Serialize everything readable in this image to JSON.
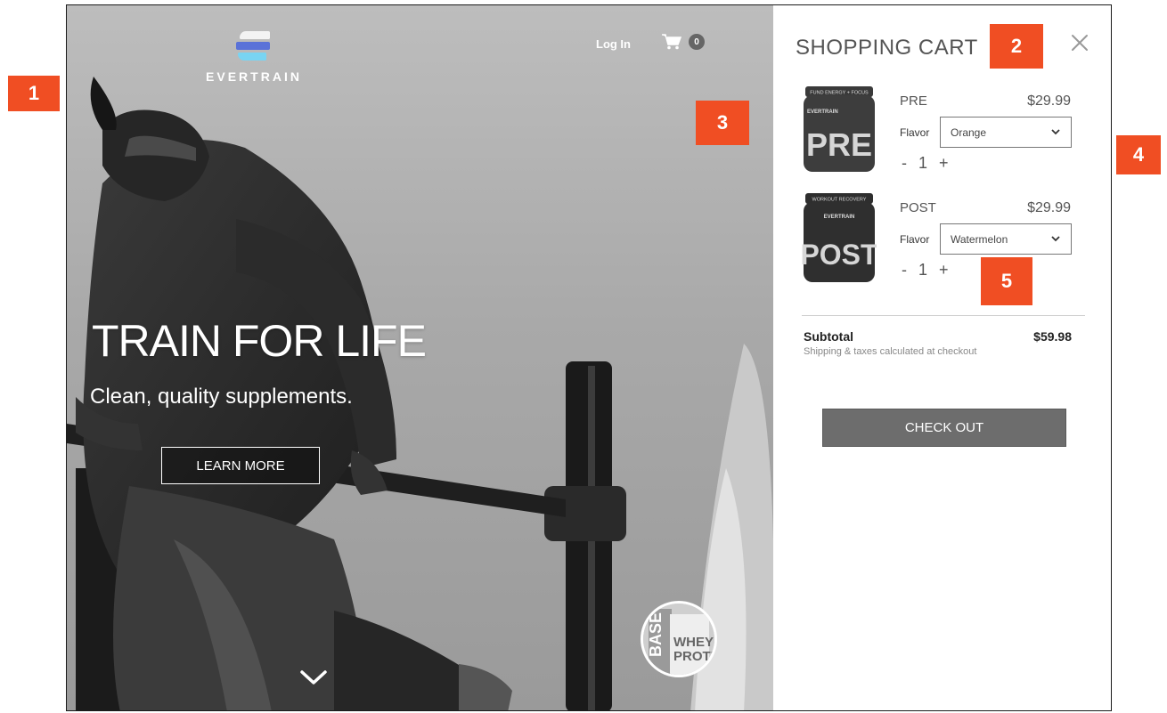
{
  "header": {
    "brand": "EVERTRAIN",
    "login_label": "Log In",
    "cart_count": "0"
  },
  "hero": {
    "title": "TRAIN FOR LIFE",
    "subtitle": "Clean, quality supplements.",
    "cta_label": "LEARN MORE"
  },
  "cart": {
    "title": "SHOPPING CART",
    "items": [
      {
        "name": "PRE",
        "price": "$29.99",
        "flavor_label": "Flavor",
        "flavor": "Orange",
        "qty": "1",
        "jar_text": "PRE",
        "jar_top_text": "FUND ENERGY + FOCUS"
      },
      {
        "name": "POST",
        "price": "$29.99",
        "flavor_label": "Flavor",
        "flavor": "Watermelon",
        "qty": "1",
        "jar_text": "POST",
        "jar_top_text": "WORKOUT RECOVERY"
      }
    ],
    "minus_label": "-",
    "plus_label": "+",
    "subtotal_label": "Subtotal",
    "subtotal_value": "$59.98",
    "shipping_note": "Shipping & taxes calculated at checkout",
    "checkout_label": "CHECK OUT",
    "jar_brand": "EVERTRAIN"
  },
  "promo": {
    "line1": "BASE",
    "line2": "WHEY",
    "line3": "PROTE"
  },
  "callouts": [
    "1",
    "2",
    "3",
    "4",
    "5"
  ],
  "colors": {
    "callout": "#f04e23",
    "checkout": "#6d6d6d",
    "logo_blue": "#5a72d8",
    "logo_cyan": "#79d4f2"
  }
}
